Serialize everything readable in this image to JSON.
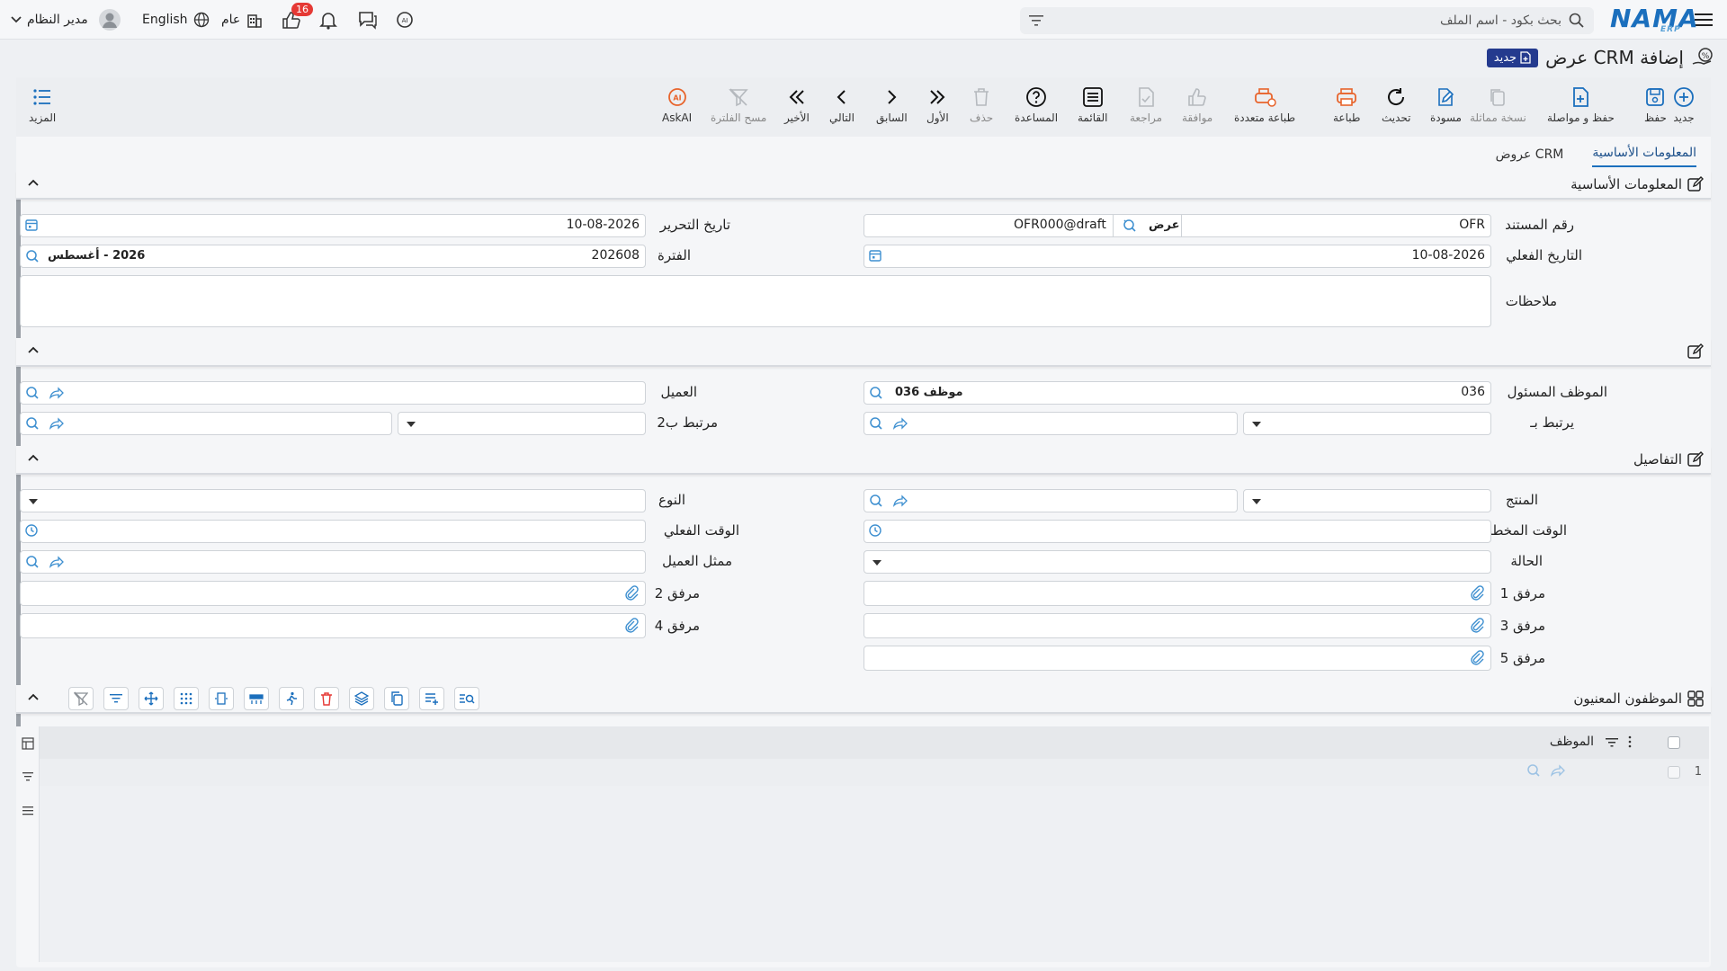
{
  "topbar": {
    "logo": "NAMA",
    "logo_sub": "ERP",
    "search_placeholder": "بحث بكود - اسم الملف",
    "user_name": "مدير النظام",
    "language": "English",
    "scope": "عام",
    "notification_count": "16"
  },
  "page": {
    "title": "إضافة CRM عرض",
    "status_badge": "جديد"
  },
  "toolbar": {
    "new": "جديد",
    "save": "حفظ",
    "save_continue": "حفظ و مواصلة",
    "duplicate": "نسخة مماثلة",
    "draft": "مسودة",
    "refresh": "تحديث",
    "print": "طباعة",
    "multi_print": "طباعة متعددة",
    "approve": "موافقة",
    "review": "مراجعة",
    "list": "القائمة",
    "help": "المساعدة",
    "delete": "حذف",
    "first": "الأول",
    "previous": "السابق",
    "next": "التالي",
    "last": "الأخير",
    "clear_filter": "مسح الفلترة",
    "askai": "AskAI",
    "more": "المزيد"
  },
  "tabs": [
    "المعلومات الأساسية",
    "CRM عروض"
  ],
  "sections": {
    "basic": "المعلومات الأساسية",
    "details": "التفاصيل",
    "employees": "الموظفون المعنيون"
  },
  "fields": {
    "doc_no_label": "رقم المستند",
    "doc_no_prefix": "OFR",
    "doc_type_tag": "عرض",
    "doc_no_value": "OFR000@draft",
    "edit_date_label": "تاريخ التحرير",
    "edit_date": "10-08-2026",
    "actual_date_label": "التاريخ الفعلي",
    "actual_date": "10-08-2026",
    "period_label": "الفترة",
    "period_value": "202608",
    "period_tag": "2026 - أغسطس",
    "notes_label": "ملاحظات",
    "responsible_label": "الموظف المسئول",
    "responsible_code": "036",
    "responsible_tag": "موظف 036",
    "customer_label": "العميل",
    "related_label": "يرتبط بـ",
    "related2_label": "مرتبط ب2",
    "product_label": "المنتج",
    "type_label": "النوع",
    "planned_time_label": "الوقت المخطط",
    "actual_time_label": "الوقت الفعلي",
    "status_label": "الحالة",
    "customer_rep_label": "ممثل العميل",
    "attachment1_label": "مرفق 1",
    "attachment2_label": "مرفق 2",
    "attachment3_label": "مرفق 3",
    "attachment4_label": "مرفق 4",
    "attachment5_label": "مرفق 5"
  },
  "grid": {
    "column_employee": "الموظف",
    "row_number": "1"
  },
  "colors": {
    "accent": "#1b6fbd",
    "badge": "#243a8e",
    "orange": "#e8642c",
    "notify": "#e53935"
  }
}
